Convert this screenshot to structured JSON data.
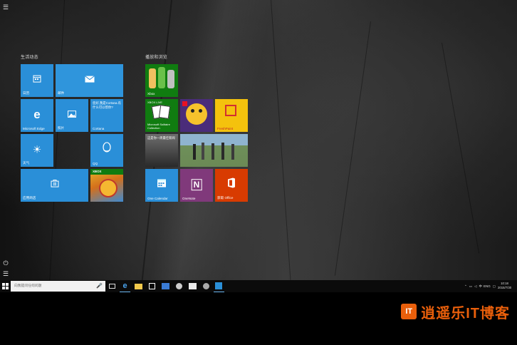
{
  "start": {
    "groups": [
      {
        "title": "生活动态"
      },
      {
        "title": "播放和浏览"
      }
    ],
    "tiles": {
      "calendar": {
        "label": "日历",
        "icon": "calendar-icon"
      },
      "mail": {
        "label": "邮件",
        "icon": "mail-icon"
      },
      "edge": {
        "label": "Microsoft Edge",
        "icon": "edge-icon"
      },
      "photos": {
        "label": "照片",
        "icon": "photos-icon"
      },
      "cortana": {
        "label": "Cortana",
        "text": "您好,我是Cortana.有什么可以帮你?"
      },
      "weather": {
        "label": "天气",
        "icon": "weather-sun-icon"
      },
      "qq": {
        "label": "QQ",
        "icon": "qq-penguin-icon"
      },
      "store": {
        "label": "应用商店",
        "icon": "store-icon"
      },
      "xbox_game": {
        "badge": "XBOX"
      },
      "xbox": {
        "label": "Xbox"
      },
      "solitaire": {
        "label": "Microsoft Solitaire Collection",
        "badge": "XBOX LIVE"
      },
      "candy": {
        "label": ""
      },
      "freshpaint": {
        "label": "FreshPaint"
      },
      "news": {
        "text": "这是你一周最佳新闻"
      },
      "people": {
        "label": ""
      },
      "onecalendar": {
        "label": "One Calendar"
      },
      "onenote": {
        "label": "OneNote"
      },
      "office": {
        "label": "获取 Office"
      }
    }
  },
  "taskbar": {
    "search_placeholder": "向我提问任何问题",
    "clock_time": "10:18",
    "clock_date": "2015/7/30",
    "tray_lang": "中",
    "tray_layout": "ENG"
  },
  "watermark": {
    "logo": "IT",
    "text": "逍遥乐IT博客"
  },
  "colors": {
    "tile_blue": "#2a8fd8",
    "xbox_green": "#107c10",
    "freshpaint_yellow": "#f4c20d",
    "onenote_purple": "#80397b",
    "office_orange": "#d83b01"
  }
}
